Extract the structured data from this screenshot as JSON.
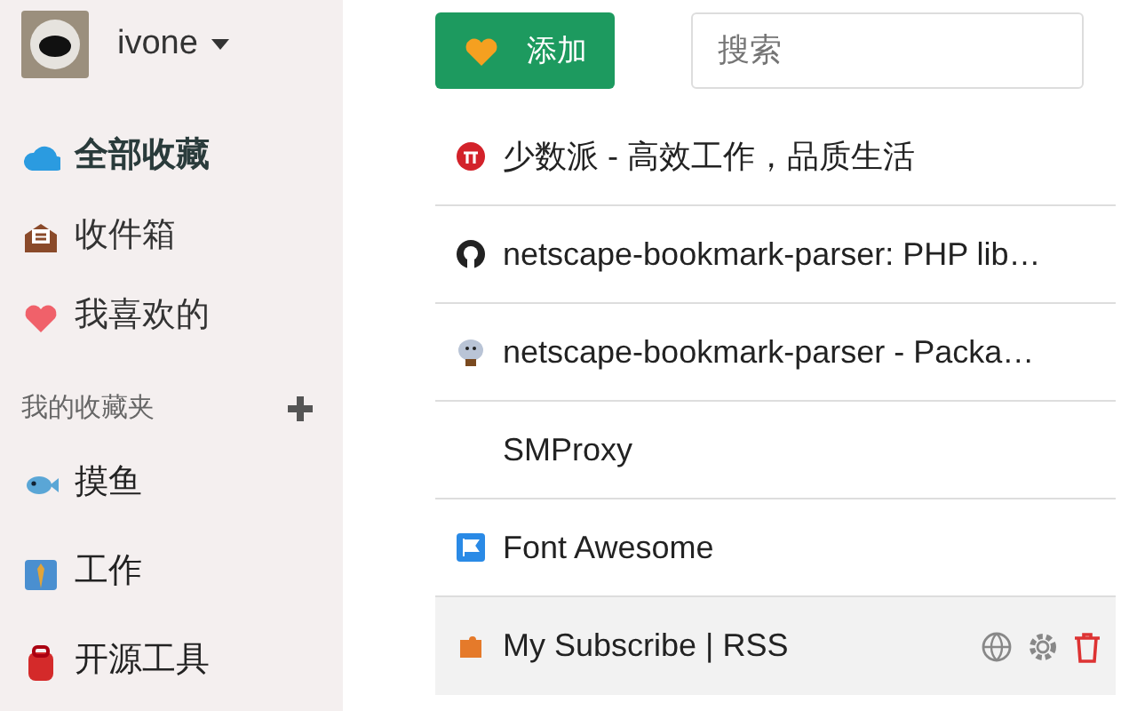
{
  "user": {
    "name": "ivone"
  },
  "nav": [
    {
      "label": "全部收藏",
      "selected": true
    },
    {
      "label": "收件箱",
      "selected": false
    },
    {
      "label": "我喜欢的",
      "selected": false
    }
  ],
  "folders_header": {
    "title": "我的收藏夹"
  },
  "folders": [
    {
      "label": "摸鱼"
    },
    {
      "label": "工作"
    },
    {
      "label": "开源工具"
    }
  ],
  "toolbar": {
    "add_button": "添加",
    "search": {
      "placeholder": "搜索"
    }
  },
  "bookmarks": [
    {
      "title": "少数派 - 高效工作，品质生活",
      "highlighted": false
    },
    {
      "title": "netscape-bookmark-parser: PHP lib…",
      "highlighted": false
    },
    {
      "title": "netscape-bookmark-parser - Packa…",
      "highlighted": false
    },
    {
      "title": "SMProxy",
      "highlighted": false
    },
    {
      "title": "Font Awesome",
      "highlighted": false
    },
    {
      "title": "My Subscribe | RSS",
      "highlighted": true
    }
  ]
}
